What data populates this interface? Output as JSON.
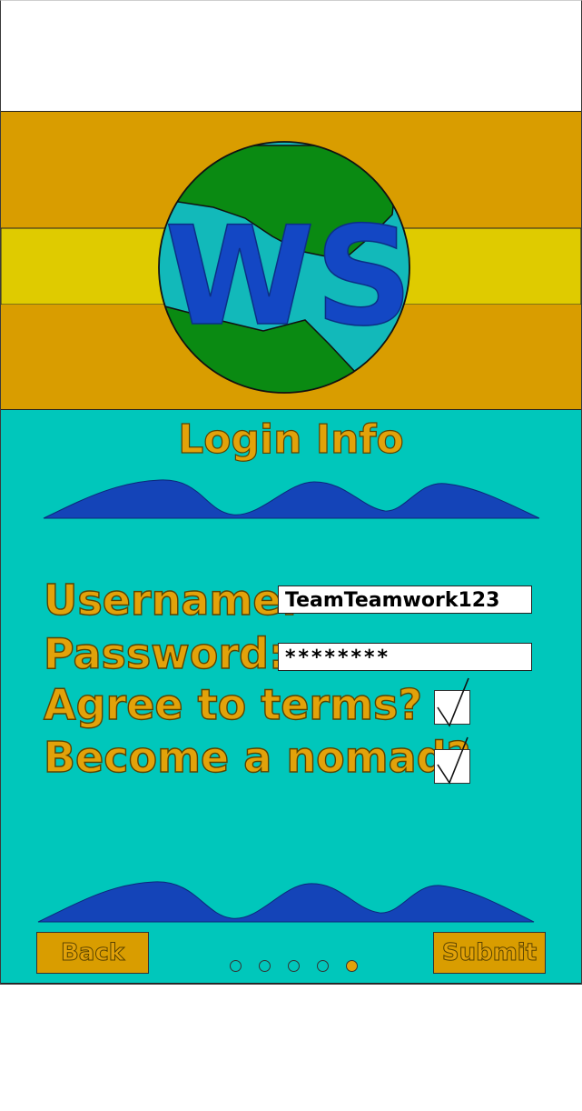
{
  "logo": {
    "text": "WS"
  },
  "form": {
    "title": "Login Info",
    "username_label": "Username:",
    "username_value": "TeamTeamwork123",
    "password_label": "Password:",
    "password_value": "********",
    "agree_label": "Agree to terms?",
    "agree_checked": true,
    "nomad_label": "Become a nomad?",
    "nomad_checked": true
  },
  "footer": {
    "back_label": "Back",
    "submit_label": "Submit",
    "pagination": {
      "total": 5,
      "current": 5
    }
  },
  "colors": {
    "header_orange": "#d99d00",
    "header_yellow": "#dfcb00",
    "teal": "#00c7bb",
    "globe_green": "#0a8a12",
    "globe_water": "#12b9ba",
    "logo_blue": "#1347c4",
    "label_gold": "#e2a20a"
  }
}
